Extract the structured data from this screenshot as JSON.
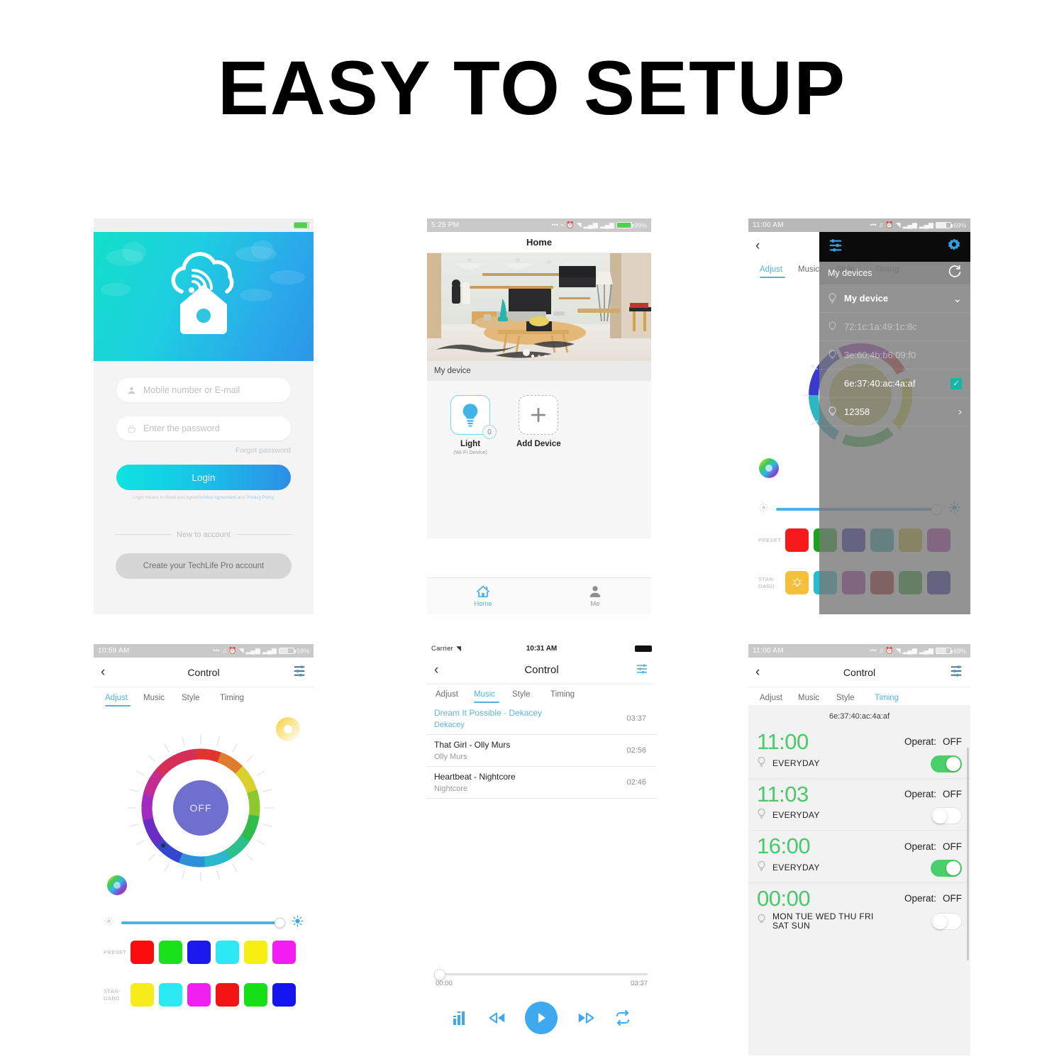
{
  "banner": {
    "title": "EASY TO SETUP"
  },
  "login_screen": {
    "status": {
      "time": "",
      "battery_pct": ""
    },
    "fields": {
      "account_placeholder": "Mobile number or E-mail",
      "account_value": "",
      "password_placeholder": "Enter the password",
      "password_value": "",
      "account_icon": "user-icon",
      "password_icon": "lock-icon"
    },
    "forgot_label": "Forgot password",
    "login_label": "Login",
    "agreement_prefix": "Login means to Read and Agree",
    "agreement_link1": "Service Agreement",
    "agreement_middle": "and",
    "agreement_link2": "Privacy Policy",
    "divider_label": "New to account",
    "create_label": "Create your TechLife Pro account",
    "brand_colors": {
      "hero_from": "#12dfc8",
      "hero_to": "#2b96e8",
      "accent": "#4fb3dd"
    }
  },
  "home_screen": {
    "status": {
      "time": "5:25 PM",
      "battery_pct": "99%"
    },
    "title": "Home",
    "section_label": "My device",
    "devices": [
      {
        "name": "Light",
        "sub": "(Wi-Fi Device)",
        "badge": "0",
        "icon": "bulb-icon"
      },
      {
        "name": "Add Device",
        "sub": "",
        "badge": "",
        "icon": "plus-icon"
      }
    ],
    "tabs": [
      {
        "label": "Home",
        "icon": "home-icon",
        "active": true
      },
      {
        "label": "Me",
        "icon": "person-icon",
        "active": false
      }
    ]
  },
  "devices_screen": {
    "status": {
      "time": "11:00 AM",
      "battery_pct": "69%"
    },
    "tabs": [
      "Adjust",
      "Music",
      "Style",
      "Timing"
    ],
    "active_tab": "Adjust",
    "drawer": {
      "title": "My devices",
      "refresh_icon": "refresh-icon",
      "settings_icon": "gear-icon",
      "sliders_icon": "sliders-icon",
      "items": [
        {
          "label": "My device",
          "trailing": "chevron-down-icon",
          "state": "group"
        },
        {
          "label": "72:1c:1a:49:1c:8c",
          "trailing": "",
          "state": "faded"
        },
        {
          "label": "3e:60:4b:b6:09:f0",
          "trailing": "",
          "state": "faded"
        },
        {
          "label": "6e:37:40:ac:4a:af",
          "trailing": "check-icon",
          "state": "selected"
        },
        {
          "label": "12358",
          "trailing": "chevron-right-icon",
          "state": "normal"
        }
      ]
    },
    "preset_label": "PRESET",
    "standard_label": "STAN-\nDARD",
    "preset_colors": [
      "#f51b1b",
      "#19a31a",
      "#1414a8",
      "#1e9fa8",
      "#bdb30d",
      "#b020ab"
    ],
    "standard_colors": [
      "#f4c03a",
      "#1fbfd0",
      "#a51f9e",
      "#a81313",
      "#179c17",
      "#17179e"
    ],
    "brightness_pct": 100
  },
  "adjust_screen": {
    "status": {
      "time": "10:59 AM",
      "battery_pct": "59%"
    },
    "title": "Control",
    "back_icon": "chevron-left-icon",
    "menu_icon": "sliders-icon",
    "tabs": [
      "Adjust",
      "Music",
      "Style",
      "Timing"
    ],
    "active_tab": "Adjust",
    "power_label": "OFF",
    "warm_icon": "warm-white-icon",
    "wheel_icon": "color-wheel-icon",
    "brightness_icon_low": "brightness-low-icon",
    "brightness_icon_high": "brightness-high-icon",
    "brightness_pct": 100,
    "preset_label": "PRESET",
    "standard_label": "STAN-\nDARD",
    "preset_colors": [
      "#fa0d0d",
      "#1ae21a",
      "#1a1aee",
      "#2ce8f4",
      "#f7ef14",
      "#f31df3"
    ],
    "standard_colors": [
      "#f7ec1b",
      "#2ae9f2",
      "#f020f0",
      "#f41414",
      "#18e018",
      "#1414f0"
    ]
  },
  "music_screen": {
    "status": {
      "carrier": "Carrier",
      "time": "10:31 AM"
    },
    "title": "Control",
    "back_icon": "chevron-left-icon",
    "menu_icon": "sliders-icon",
    "tabs": [
      "Adjust",
      "Music",
      "Style",
      "Timing"
    ],
    "active_tab": "Music",
    "songs": [
      {
        "title": "Dream It Possible - Dekacey",
        "artist": "Dekacey",
        "duration": "03:37",
        "current": true
      },
      {
        "title": "That Girl - Olly Murs",
        "artist": "Olly Murs",
        "duration": "02:56",
        "current": false
      },
      {
        "title": "Heartbeat - Nightcore",
        "artist": "Nightcore",
        "duration": "02:46",
        "current": false
      }
    ],
    "elapsed": "00:00",
    "total": "03:37",
    "progress_pct": 0,
    "controls": [
      {
        "name": "equalizer-icon"
      },
      {
        "name": "rewind-icon"
      },
      {
        "name": "play-icon"
      },
      {
        "name": "fast-forward-icon"
      },
      {
        "name": "repeat-icon"
      }
    ]
  },
  "timing_screen": {
    "status": {
      "time": "11:00 AM",
      "battery_pct": "68%"
    },
    "title": "Control",
    "back_icon": "chevron-left-icon",
    "menu_icon": "sliders-icon",
    "tabs": [
      "Adjust",
      "Music",
      "Style",
      "Timing"
    ],
    "active_tab": "Timing",
    "device_mac": "6e:37:40:ac:4a:af",
    "operat_label": "Operat:",
    "timers": [
      {
        "time": "11:00",
        "operation": "OFF",
        "days": "EVERYDAY",
        "enabled": true
      },
      {
        "time": "11:03",
        "operation": "OFF",
        "days": "EVERYDAY",
        "enabled": false
      },
      {
        "time": "16:00",
        "operation": "OFF",
        "days": "EVERYDAY",
        "enabled": true
      },
      {
        "time": "00:00",
        "operation": "OFF",
        "days": "MON TUE WED THU FRI SAT SUN",
        "enabled": false
      }
    ]
  }
}
